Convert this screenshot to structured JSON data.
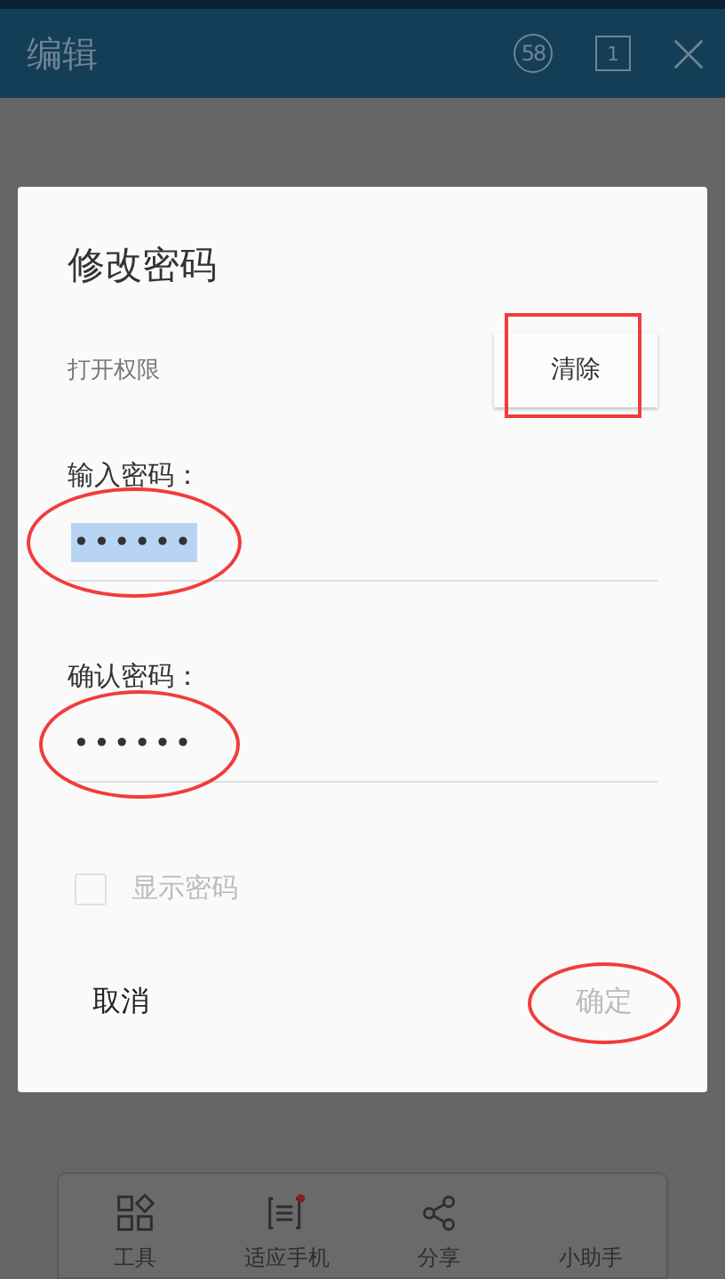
{
  "header": {
    "title": "编辑",
    "badge_count": "58",
    "page_count": "1"
  },
  "dialog": {
    "title": "修改密码",
    "permission_label": "打开权限",
    "clear_button": "清除",
    "fields": [
      {
        "label": "输入密码：",
        "value": "••••••",
        "selected": true
      },
      {
        "label": "确认密码：",
        "value": "••••••",
        "selected": false
      }
    ],
    "show_password": {
      "label": "显示密码",
      "checked": false,
      "disabled": true
    },
    "cancel_button": {
      "label": "取消",
      "disabled": false
    },
    "confirm_button": {
      "label": "确定",
      "disabled": true
    }
  },
  "toolbar": {
    "items": [
      {
        "kind": "grid",
        "label": "工具",
        "notification": false
      },
      {
        "kind": "fit",
        "label": "适应手机",
        "notification": true
      },
      {
        "kind": "share",
        "label": "分享",
        "notification": false
      },
      {
        "kind": "none",
        "label": "小助手",
        "notification": false
      }
    ]
  }
}
